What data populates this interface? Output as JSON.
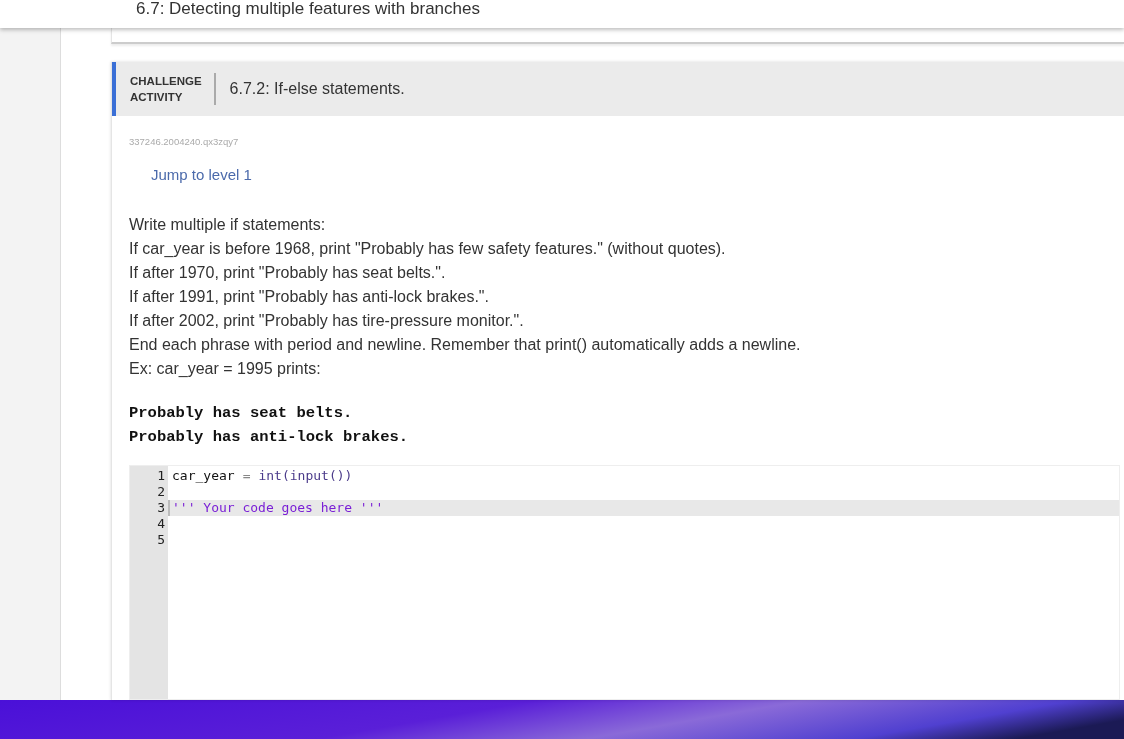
{
  "header": {
    "title": "6.7: Detecting multiple features with branches"
  },
  "activity": {
    "badge_lines": [
      "CHALLENGE",
      "ACTIVITY"
    ],
    "title": "6.7.2: If-else statements.",
    "id": "337246.2004240.qx3zqy7",
    "jump_link": "Jump to level 1"
  },
  "instructions": [
    "Write multiple if statements:",
    "If car_year is before 1968, print \"Probably has few safety features.\" (without quotes).",
    "If after 1970, print \"Probably has seat belts.\".",
    "If after 1991, print \"Probably has anti-lock brakes.\".",
    "If after 2002, print \"Probably has tire-pressure monitor.\".",
    "End each phrase with period and newline. Remember that print() automatically adds a newline.",
    "Ex: car_year = 1995 prints:"
  ],
  "example_output": [
    "Probably has seat belts.",
    "Probably has anti-lock brakes."
  ],
  "editor": {
    "lines": [
      {
        "number": "1",
        "active": false,
        "tokens": [
          {
            "kind": "name",
            "text": "car_year"
          },
          {
            "kind": "operator",
            "text": "="
          },
          {
            "kind": "builtin",
            "text": "int(input())"
          }
        ]
      },
      {
        "number": "2",
        "active": false
      },
      {
        "number": "3",
        "active": true,
        "tokens": [
          {
            "kind": "string",
            "text": "''' Your code goes here '''"
          }
        ]
      },
      {
        "number": "4",
        "active": false
      },
      {
        "number": "5",
        "active": false
      }
    ]
  }
}
